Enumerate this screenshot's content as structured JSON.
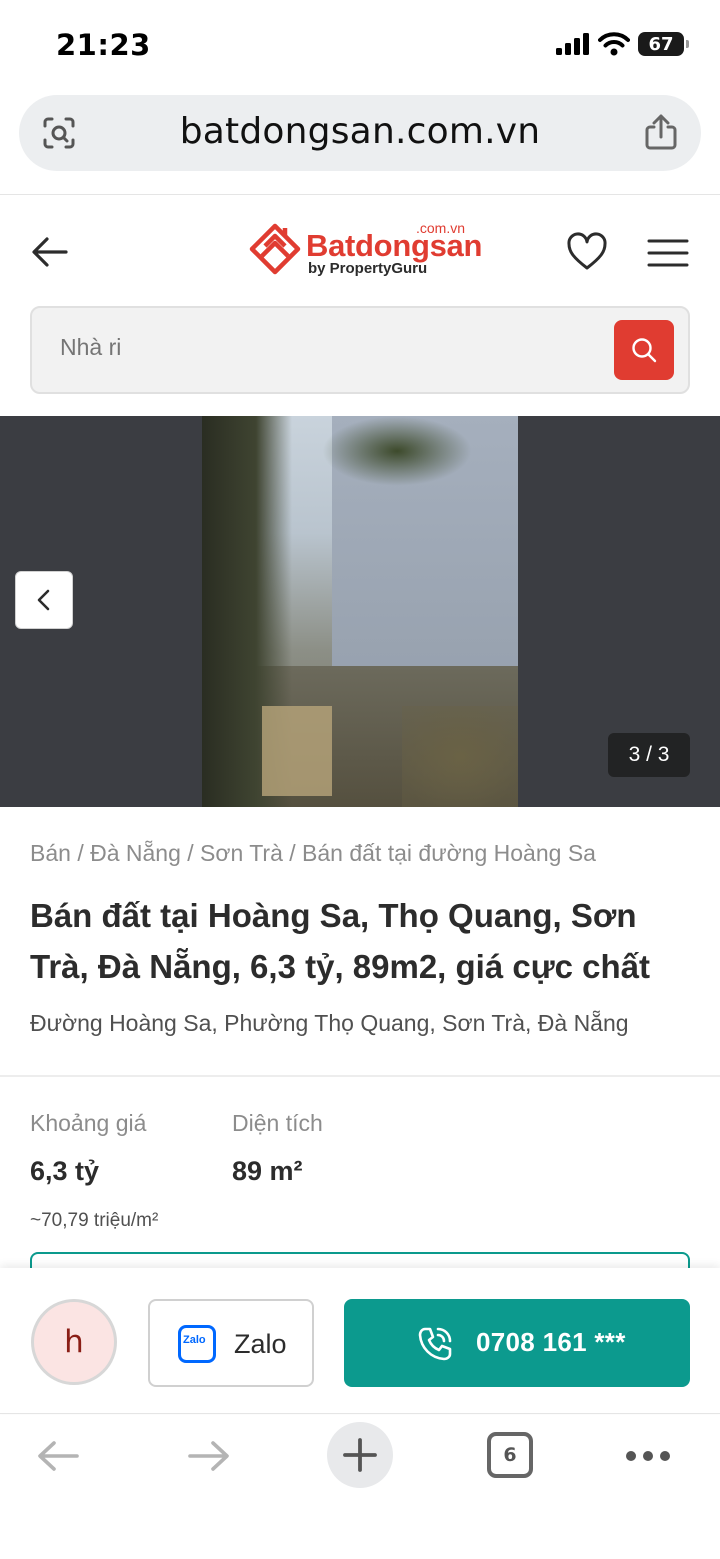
{
  "status_bar": {
    "time": "21:23",
    "battery": "67"
  },
  "browser": {
    "url": "batdongsan.com.vn",
    "open_tabs": "6"
  },
  "site": {
    "logo_name": "Batdongsan",
    "logo_domain": ".com.vn",
    "logo_sub": "by PropertyGuru",
    "brand_color": "#e03c31",
    "accent_color": "#0c9a8e"
  },
  "search": {
    "placeholder": "Nhà ri"
  },
  "gallery": {
    "counter": "3 / 3"
  },
  "listing": {
    "breadcrumb": "Bán / Đà Nẵng / Sơn Trà / Bán đất tại đường Hoàng Sa",
    "title": "Bán đất tại Hoàng Sa, Thọ Quang, Sơn Trà, Đà Nẵng, 6,3 tỷ, 89m2, giá cực chất",
    "address": "Đường Hoàng Sa, Phường Thọ Quang, Sơn Trà, Đà Nẵng",
    "price_label": "Khoảng giá",
    "price_value": "6,3 tỷ",
    "price_per_m2": "~70,79 triệu/m²",
    "area_label": "Diện tích",
    "area_value": "89 m²"
  },
  "contact": {
    "avatar_initial": "h",
    "zalo_label": "Zalo",
    "zalo_logo_text": "Zalo",
    "phone": "0708 161 ***"
  },
  "icons": {
    "url_left": "lens-icon",
    "url_right": "share-icon",
    "header_back": "arrow-left-icon",
    "favorite": "heart-icon",
    "menu": "hamburger-icon",
    "search": "search-icon",
    "gallery_prev": "chevron-left-icon",
    "call": "phone-icon",
    "toolbar": [
      "back-icon",
      "forward-icon",
      "new-tab-icon",
      "tabs-icon",
      "more-icon"
    ]
  }
}
